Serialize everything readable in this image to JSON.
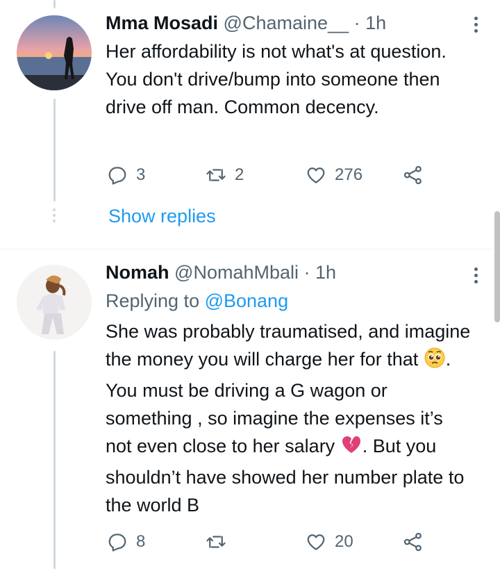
{
  "tweets": [
    {
      "display_name": "Mma Mosadi",
      "handle": "@Chamaine__",
      "separator": "·",
      "time": "1h",
      "text": "Her affordability is not what's at question. You don't drive/bump into someone then drive off man. Common decency.",
      "replies": "3",
      "retweets": "2",
      "likes": "276"
    },
    {
      "display_name": "Nomah",
      "handle": "@NomahMbali",
      "separator": "·",
      "time": "1h",
      "replying_prefix": "Replying to ",
      "replying_to": "@Bonang",
      "text_part1": "She was probably traumatised, and imagine the money you will charge her for that ",
      "emoji1": "pleading-face",
      "text_part2": ". You must be driving a G wagon or something , so imagine the expenses it’s not even close to her salary ",
      "emoji2": "broken-heart",
      "text_part3": ". But you shouldn’t have showed her number plate to the world B",
      "replies": "8",
      "retweets": "",
      "likes": "20"
    }
  ],
  "show_replies_label": "Show replies",
  "colors": {
    "link": "#1d9bf0",
    "secondary": "#536471",
    "thread": "#cfd9de"
  }
}
